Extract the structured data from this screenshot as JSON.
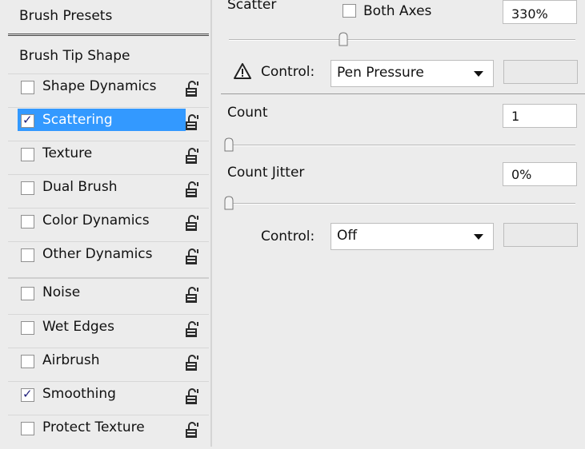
{
  "sidebar": {
    "presets_label": "Brush Presets",
    "tip_shape_label": "Brush Tip Shape",
    "items": [
      {
        "label": "Shape Dynamics",
        "checked": false,
        "selected": false
      },
      {
        "label": "Scattering",
        "checked": true,
        "selected": true
      },
      {
        "label": "Texture",
        "checked": false,
        "selected": false
      },
      {
        "label": "Dual Brush",
        "checked": false,
        "selected": false
      },
      {
        "label": "Color Dynamics",
        "checked": false,
        "selected": false
      },
      {
        "label": "Other Dynamics",
        "checked": false,
        "selected": false
      },
      {
        "label": "Noise",
        "checked": false,
        "selected": false
      },
      {
        "label": "Wet Edges",
        "checked": false,
        "selected": false
      },
      {
        "label": "Airbrush",
        "checked": false,
        "selected": false
      },
      {
        "label": "Smoothing",
        "checked": true,
        "selected": false
      },
      {
        "label": "Protect Texture",
        "checked": false,
        "selected": false
      }
    ]
  },
  "scatter": {
    "label": "Scatter",
    "both_axes_label": "Both Axes",
    "both_axes_checked": false,
    "value": "330%",
    "slider_fraction": 0.33,
    "control_label": "Control:",
    "control_value": "Pen Pressure"
  },
  "count": {
    "label": "Count",
    "value": "1",
    "slider_fraction": 0.0
  },
  "count_jitter": {
    "label": "Count Jitter",
    "value": "0%",
    "slider_fraction": 0.0,
    "control_label": "Control:",
    "control_value": "Off"
  },
  "colors": {
    "selection": "#3399ff"
  },
  "icons": {
    "lock": "lock-icon",
    "warning": "warning-icon",
    "checkmark": "✓"
  }
}
